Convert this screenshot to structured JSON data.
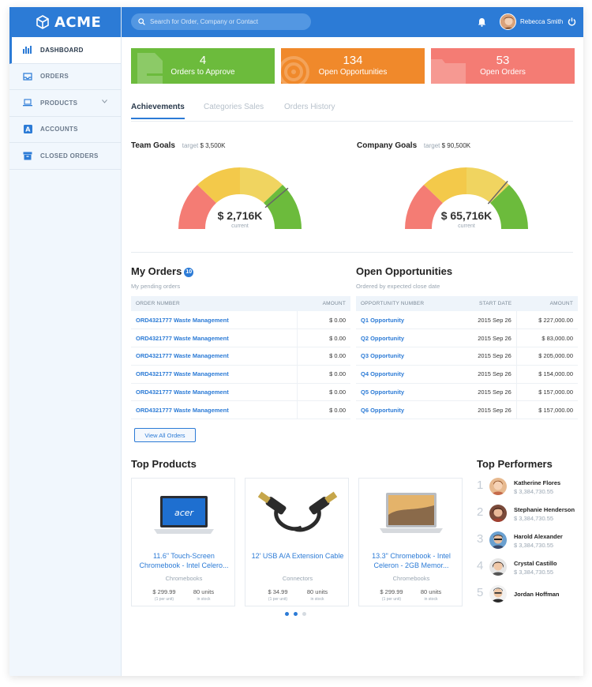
{
  "brand": {
    "name": "ACME"
  },
  "search": {
    "placeholder": "Search for Order, Company or Contact"
  },
  "user": {
    "name": "Rebecca Smith"
  },
  "sidebar": {
    "items": [
      {
        "label": "DASHBOARD",
        "icon": "bar-chart-icon",
        "active": true
      },
      {
        "label": "ORDERS",
        "icon": "inbox-icon"
      },
      {
        "label": "PRODUCTS",
        "icon": "laptop-icon"
      },
      {
        "label": "ACCOUNTS",
        "icon": "account-icon"
      },
      {
        "label": "CLOSED ORDERS",
        "icon": "archive-icon"
      }
    ]
  },
  "stats": [
    {
      "value": "4",
      "label": "Orders to Approve",
      "color": "#6cbb3c"
    },
    {
      "value": "134",
      "label": "Open Opportunities",
      "color": "#f0892b"
    },
    {
      "value": "53",
      "label": "Open Orders",
      "color": "#f47c74"
    }
  ],
  "tabs": [
    "Achievements",
    "Categories Sales",
    "Orders History"
  ],
  "goals": {
    "team": {
      "title": "Team Goals",
      "target_label": "target",
      "target": "$ 3,500K",
      "current": "$ 2,716K",
      "current_label": "current",
      "fraction": 0.776
    },
    "company": {
      "title": "Company Goals",
      "target_label": "target",
      "target": "$ 90,500K",
      "current": "$ 65,716K",
      "current_label": "current",
      "fraction": 0.726
    }
  },
  "my_orders": {
    "title": "My Orders",
    "badge": "10",
    "subtitle": "My pending orders",
    "col_number": "ORDER NUMBER",
    "col_amount": "AMOUNT",
    "rows": [
      {
        "number": "ORD4321777 Waste Management",
        "amount": "$ 0.00"
      },
      {
        "number": "ORD4321777 Waste Management",
        "amount": "$ 0.00"
      },
      {
        "number": "ORD4321777 Waste Management",
        "amount": "$ 0.00"
      },
      {
        "number": "ORD4321777 Waste Management",
        "amount": "$ 0.00"
      },
      {
        "number": "ORD4321777 Waste Management",
        "amount": "$ 0.00"
      },
      {
        "number": "ORD4321777 Waste Management",
        "amount": "$ 0.00"
      }
    ],
    "view_all": "View All Orders"
  },
  "opportunities": {
    "title": "Open Opportunities",
    "subtitle": "Ordered by expected close date",
    "col_number": "OPPORTUNITY NUMBER",
    "col_date": "START DATE",
    "col_amount": "AMOUNT",
    "rows": [
      {
        "number": "Q1 Opportunity",
        "date": "2015 Sep 26",
        "amount": "$ 227,000.00"
      },
      {
        "number": "Q2 Opportunity",
        "date": "2015 Sep 26",
        "amount": "$ 83,000.00"
      },
      {
        "number": "Q3 Opportunity",
        "date": "2015 Sep 26",
        "amount": "$ 205,000.00"
      },
      {
        "number": "Q4 Opportunity",
        "date": "2015 Sep 26",
        "amount": "$ 154,000.00"
      },
      {
        "number": "Q5 Opportunity",
        "date": "2015 Sep 26",
        "amount": "$ 157,000.00"
      },
      {
        "number": "Q6 Opportunity",
        "date": "2015 Sep 26",
        "amount": "$ 157,000.00"
      }
    ]
  },
  "top_products": {
    "title": "Top Products",
    "items": [
      {
        "name": "11.6\" Touch-Screen Chromebook - Intel Celero...",
        "category": "Chromebooks",
        "price": "$ 299.99",
        "price_note": "(1 per unit)",
        "stock": "80 units",
        "stock_note": "in stock"
      },
      {
        "name": "12' USB A/A Extension Cable",
        "category": "Connectors",
        "price": "$ 34.99",
        "price_note": "(1 per unit)",
        "stock": "80 units",
        "stock_note": "in stock"
      },
      {
        "name": "13.3\" Chromebook - Intel Celeron - 2GB Memor...",
        "category": "Chromebooks",
        "price": "$ 299.99",
        "price_note": "(1 per unit)",
        "stock": "80 units",
        "stock_note": "in stock"
      }
    ]
  },
  "top_performers": {
    "title": "Top Performers",
    "items": [
      {
        "rank": "1",
        "name": "Katherine Flores",
        "amount": "$ 3,384,730.55"
      },
      {
        "rank": "2",
        "name": "Stephanie Henderson",
        "amount": "$ 3,384,730.55"
      },
      {
        "rank": "3",
        "name": "Harold Alexander",
        "amount": "$ 3,384,730.55"
      },
      {
        "rank": "4",
        "name": "Crystal Castillo",
        "amount": "$ 3,384,730.55"
      },
      {
        "rank": "5",
        "name": "Jordan Hoffman",
        "amount": ""
      }
    ]
  },
  "colors": {
    "primary": "#2c7bd6",
    "green": "#6cbb3c",
    "orange": "#f0892b",
    "red": "#f47c74"
  }
}
